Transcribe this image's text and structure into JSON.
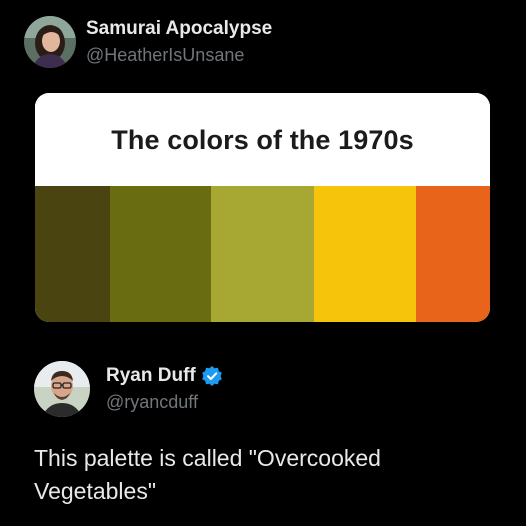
{
  "post_1": {
    "display_name": "Samurai Apocalypse",
    "handle": "@HeatherIsUnsane",
    "avatar_icon": "user-avatar-woman-icon"
  },
  "palette_card": {
    "title": "The colors of the 1970s",
    "swatches": [
      {
        "color": "#4a4411"
      },
      {
        "color": "#6a6c12"
      },
      {
        "color": "#a7a834"
      },
      {
        "color": "#f6c40b"
      },
      {
        "color": "#e8641a"
      }
    ]
  },
  "post_2": {
    "display_name": "Ryan Duff",
    "handle": "@ryancduff",
    "avatar_icon": "user-avatar-man-icon",
    "verified_icon": "verified-badge-icon",
    "verified_color": "#1d9bf0",
    "text": "This palette is called \"Overcooked Vegetables\""
  },
  "colors": {
    "background": "#000000",
    "primary_text": "#e7e9ea",
    "secondary_text": "#71767b",
    "card_background": "#ffffff",
    "card_title_text": "#1b1b1b"
  }
}
